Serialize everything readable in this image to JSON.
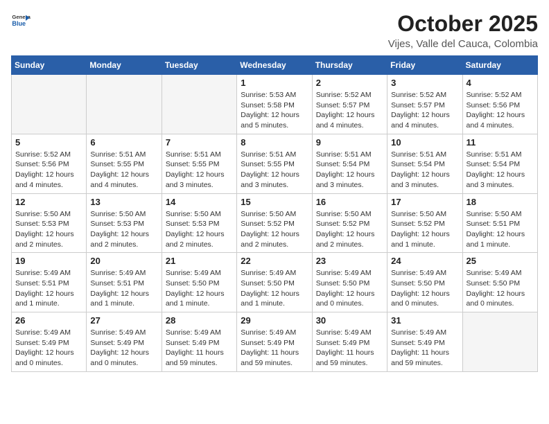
{
  "header": {
    "logo_general": "General",
    "logo_blue": "Blue",
    "month_title": "October 2025",
    "location": "Vijes, Valle del Cauca, Colombia"
  },
  "days_of_week": [
    "Sunday",
    "Monday",
    "Tuesday",
    "Wednesday",
    "Thursday",
    "Friday",
    "Saturday"
  ],
  "weeks": [
    [
      {
        "day": "",
        "info": ""
      },
      {
        "day": "",
        "info": ""
      },
      {
        "day": "",
        "info": ""
      },
      {
        "day": "1",
        "info": "Sunrise: 5:53 AM\nSunset: 5:58 PM\nDaylight: 12 hours\nand 5 minutes."
      },
      {
        "day": "2",
        "info": "Sunrise: 5:52 AM\nSunset: 5:57 PM\nDaylight: 12 hours\nand 4 minutes."
      },
      {
        "day": "3",
        "info": "Sunrise: 5:52 AM\nSunset: 5:57 PM\nDaylight: 12 hours\nand 4 minutes."
      },
      {
        "day": "4",
        "info": "Sunrise: 5:52 AM\nSunset: 5:56 PM\nDaylight: 12 hours\nand 4 minutes."
      }
    ],
    [
      {
        "day": "5",
        "info": "Sunrise: 5:52 AM\nSunset: 5:56 PM\nDaylight: 12 hours\nand 4 minutes."
      },
      {
        "day": "6",
        "info": "Sunrise: 5:51 AM\nSunset: 5:55 PM\nDaylight: 12 hours\nand 4 minutes."
      },
      {
        "day": "7",
        "info": "Sunrise: 5:51 AM\nSunset: 5:55 PM\nDaylight: 12 hours\nand 3 minutes."
      },
      {
        "day": "8",
        "info": "Sunrise: 5:51 AM\nSunset: 5:55 PM\nDaylight: 12 hours\nand 3 minutes."
      },
      {
        "day": "9",
        "info": "Sunrise: 5:51 AM\nSunset: 5:54 PM\nDaylight: 12 hours\nand 3 minutes."
      },
      {
        "day": "10",
        "info": "Sunrise: 5:51 AM\nSunset: 5:54 PM\nDaylight: 12 hours\nand 3 minutes."
      },
      {
        "day": "11",
        "info": "Sunrise: 5:51 AM\nSunset: 5:54 PM\nDaylight: 12 hours\nand 3 minutes."
      }
    ],
    [
      {
        "day": "12",
        "info": "Sunrise: 5:50 AM\nSunset: 5:53 PM\nDaylight: 12 hours\nand 2 minutes."
      },
      {
        "day": "13",
        "info": "Sunrise: 5:50 AM\nSunset: 5:53 PM\nDaylight: 12 hours\nand 2 minutes."
      },
      {
        "day": "14",
        "info": "Sunrise: 5:50 AM\nSunset: 5:53 PM\nDaylight: 12 hours\nand 2 minutes."
      },
      {
        "day": "15",
        "info": "Sunrise: 5:50 AM\nSunset: 5:52 PM\nDaylight: 12 hours\nand 2 minutes."
      },
      {
        "day": "16",
        "info": "Sunrise: 5:50 AM\nSunset: 5:52 PM\nDaylight: 12 hours\nand 2 minutes."
      },
      {
        "day": "17",
        "info": "Sunrise: 5:50 AM\nSunset: 5:52 PM\nDaylight: 12 hours\nand 1 minute."
      },
      {
        "day": "18",
        "info": "Sunrise: 5:50 AM\nSunset: 5:51 PM\nDaylight: 12 hours\nand 1 minute."
      }
    ],
    [
      {
        "day": "19",
        "info": "Sunrise: 5:49 AM\nSunset: 5:51 PM\nDaylight: 12 hours\nand 1 minute."
      },
      {
        "day": "20",
        "info": "Sunrise: 5:49 AM\nSunset: 5:51 PM\nDaylight: 12 hours\nand 1 minute."
      },
      {
        "day": "21",
        "info": "Sunrise: 5:49 AM\nSunset: 5:50 PM\nDaylight: 12 hours\nand 1 minute."
      },
      {
        "day": "22",
        "info": "Sunrise: 5:49 AM\nSunset: 5:50 PM\nDaylight: 12 hours\nand 1 minute."
      },
      {
        "day": "23",
        "info": "Sunrise: 5:49 AM\nSunset: 5:50 PM\nDaylight: 12 hours\nand 0 minutes."
      },
      {
        "day": "24",
        "info": "Sunrise: 5:49 AM\nSunset: 5:50 PM\nDaylight: 12 hours\nand 0 minutes."
      },
      {
        "day": "25",
        "info": "Sunrise: 5:49 AM\nSunset: 5:50 PM\nDaylight: 12 hours\nand 0 minutes."
      }
    ],
    [
      {
        "day": "26",
        "info": "Sunrise: 5:49 AM\nSunset: 5:49 PM\nDaylight: 12 hours\nand 0 minutes."
      },
      {
        "day": "27",
        "info": "Sunrise: 5:49 AM\nSunset: 5:49 PM\nDaylight: 12 hours\nand 0 minutes."
      },
      {
        "day": "28",
        "info": "Sunrise: 5:49 AM\nSunset: 5:49 PM\nDaylight: 11 hours\nand 59 minutes."
      },
      {
        "day": "29",
        "info": "Sunrise: 5:49 AM\nSunset: 5:49 PM\nDaylight: 11 hours\nand 59 minutes."
      },
      {
        "day": "30",
        "info": "Sunrise: 5:49 AM\nSunset: 5:49 PM\nDaylight: 11 hours\nand 59 minutes."
      },
      {
        "day": "31",
        "info": "Sunrise: 5:49 AM\nSunset: 5:49 PM\nDaylight: 11 hours\nand 59 minutes."
      },
      {
        "day": "",
        "info": ""
      }
    ]
  ]
}
